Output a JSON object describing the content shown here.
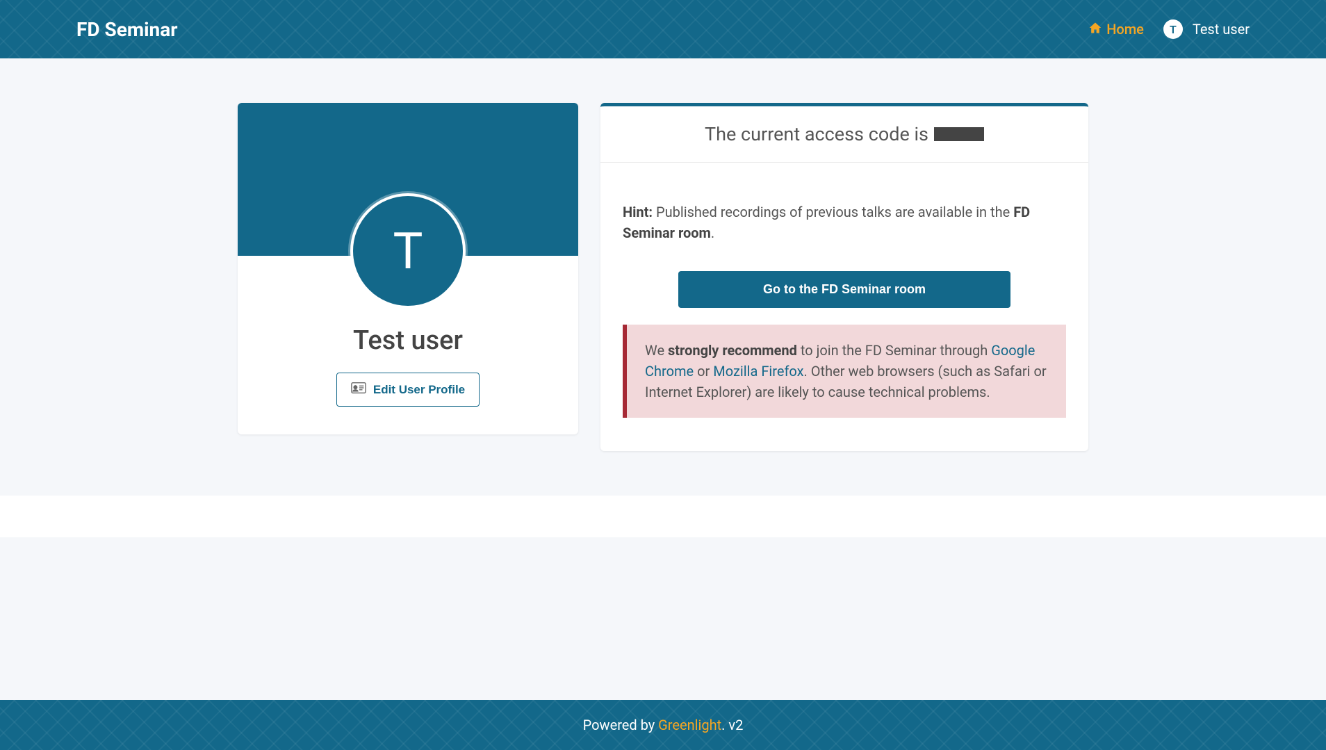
{
  "header": {
    "brand": "FD Seminar",
    "nav": {
      "home_label": "Home",
      "user_initial": "T",
      "user_name": "Test user"
    }
  },
  "profile": {
    "avatar_initial": "T",
    "name": "Test user",
    "edit_button_label": "Edit User Profile"
  },
  "main": {
    "access_code_prefix": "The current access code is",
    "hint_label": "Hint:",
    "hint_text_1": " Published recordings of previous talks are available in the ",
    "hint_room": "FD Seminar room",
    "hint_text_2": ".",
    "go_button_label": "Go to the FD Seminar room",
    "warning": {
      "prefix": "We ",
      "strong": "strongly recommend",
      "mid1": " to join the FD Seminar through ",
      "link1": "Google Chrome",
      "mid2": " or ",
      "link2": "Mozilla Firefox",
      "suffix": ". Other web browsers (such as Safari or Internet Explorer) are likely to cause technical problems."
    }
  },
  "footer": {
    "prefix": "Powered by ",
    "link": "Greenlight",
    "suffix": ". v2"
  }
}
